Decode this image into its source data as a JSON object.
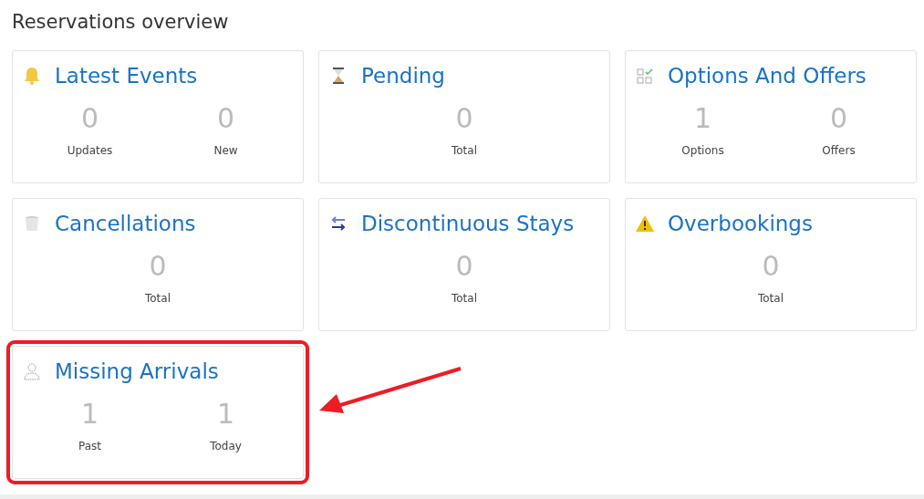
{
  "page_title": "Reservations overview",
  "cards": [
    {
      "title": "Latest Events",
      "highlighted": false,
      "stats": [
        {
          "value": "0",
          "label": "Updates"
        },
        {
          "value": "0",
          "label": "New"
        }
      ]
    },
    {
      "title": "Pending",
      "highlighted": false,
      "stats": [
        {
          "value": "0",
          "label": "Total"
        }
      ]
    },
    {
      "title": "Options And Offers",
      "highlighted": false,
      "stats": [
        {
          "value": "1",
          "label": "Options"
        },
        {
          "value": "0",
          "label": "Offers"
        }
      ]
    },
    {
      "title": "Cancellations",
      "highlighted": false,
      "stats": [
        {
          "value": "0",
          "label": "Total"
        }
      ]
    },
    {
      "title": "Discontinuous Stays",
      "highlighted": false,
      "stats": [
        {
          "value": "0",
          "label": "Total"
        }
      ]
    },
    {
      "title": "Overbookings",
      "highlighted": false,
      "stats": [
        {
          "value": "0",
          "label": "Total"
        }
      ]
    },
    {
      "title": "Missing Arrivals",
      "highlighted": true,
      "stats": [
        {
          "value": "1",
          "label": "Past"
        },
        {
          "value": "1",
          "label": "Today"
        }
      ]
    }
  ]
}
